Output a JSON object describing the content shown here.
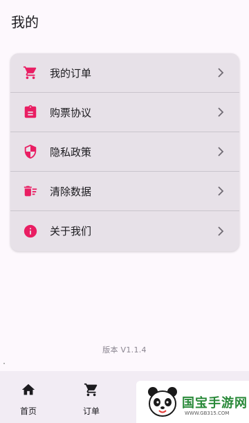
{
  "header": {
    "title": "我的"
  },
  "menu": {
    "items": [
      {
        "label": "我的订单",
        "icon": "cart-icon"
      },
      {
        "label": "购票协议",
        "icon": "clipboard-icon"
      },
      {
        "label": "隐私政策",
        "icon": "shield-icon"
      },
      {
        "label": "清除数据",
        "icon": "delete-sweep-icon"
      },
      {
        "label": "关于我们",
        "icon": "info-icon"
      }
    ]
  },
  "footer": {
    "version": "版本 V1.1.4"
  },
  "bottom_nav": {
    "items": [
      {
        "label": "首页",
        "icon": "home-icon"
      },
      {
        "label": "订单",
        "icon": "cart-icon"
      }
    ]
  },
  "watermark": {
    "title": "国宝手游网",
    "url": "WWW.GB315.COM"
  },
  "colors": {
    "accent": "#e91e63",
    "card": "#e7e1e8",
    "background": "#fdf8fd",
    "nav": "#f2ecf4"
  }
}
